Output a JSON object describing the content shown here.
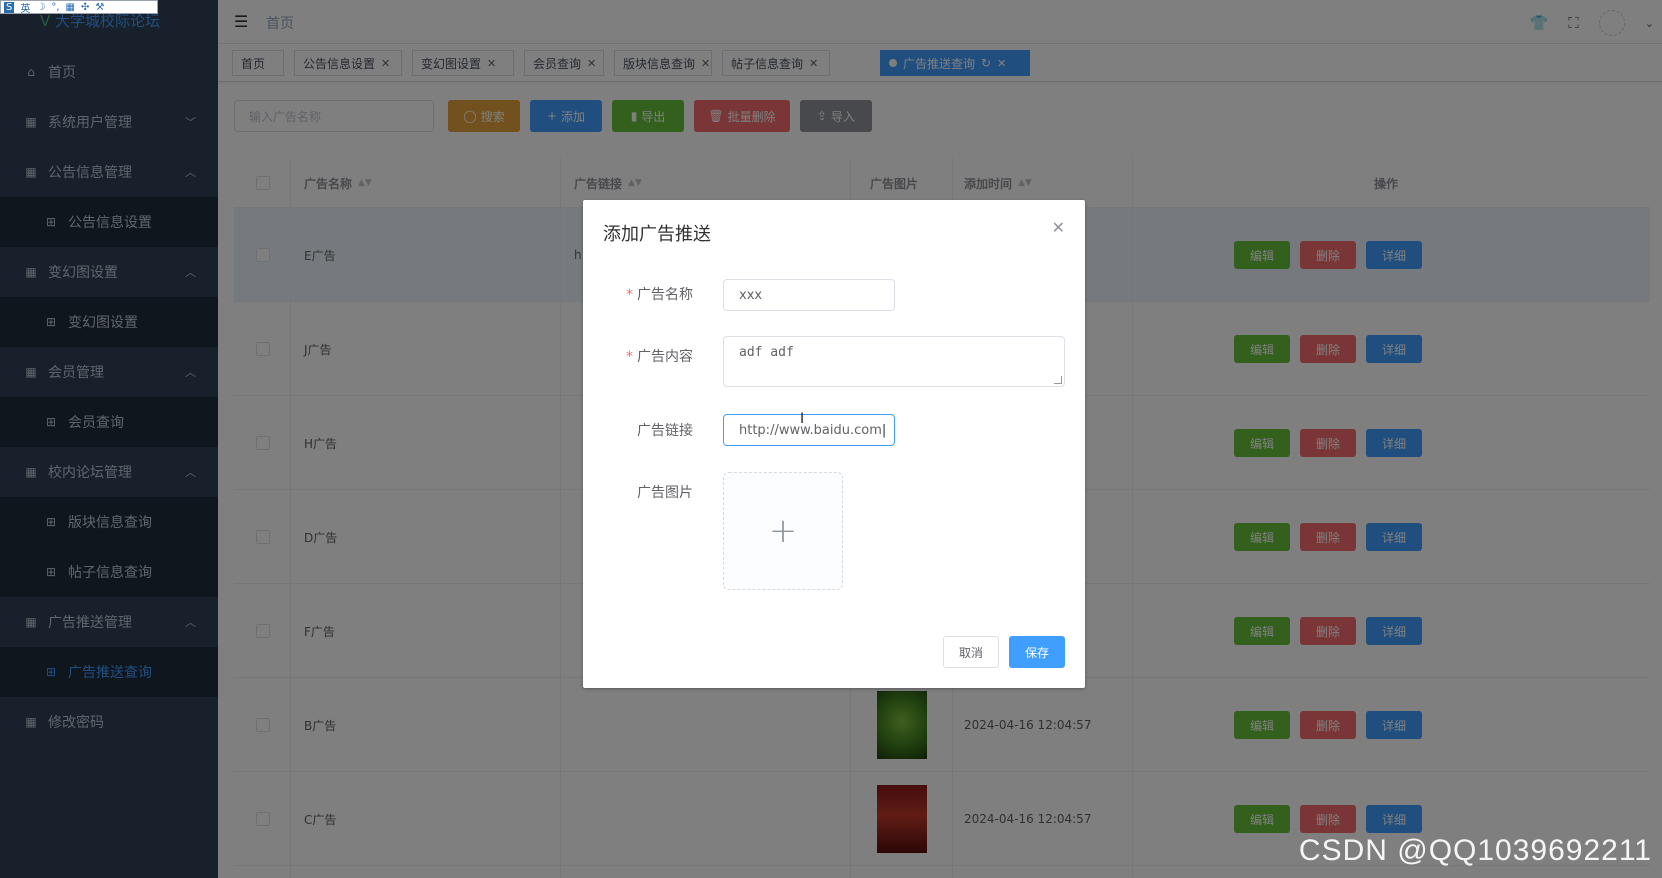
{
  "ime": {
    "items": [
      "S",
      "英",
      "☽",
      "°,",
      "▦",
      "✣",
      "🔧"
    ]
  },
  "sidebar": {
    "logo": "大学城校际论坛",
    "items": [
      {
        "label": "首页",
        "icon": "home-icon",
        "type": "top"
      },
      {
        "label": "系统用户管理",
        "icon": "grid-icon",
        "type": "group",
        "arrow": "down"
      },
      {
        "label": "公告信息管理",
        "icon": "grid-icon",
        "type": "group",
        "arrow": "up"
      },
      {
        "label": "公告信息设置",
        "icon": "apps-icon",
        "type": "sub"
      },
      {
        "label": "变幻图设置",
        "icon": "grid-icon",
        "type": "group",
        "arrow": "up"
      },
      {
        "label": "变幻图设置",
        "icon": "apps-icon",
        "type": "sub"
      },
      {
        "label": "会员管理",
        "icon": "grid-icon",
        "type": "group",
        "arrow": "up"
      },
      {
        "label": "会员查询",
        "icon": "apps-icon",
        "type": "sub"
      },
      {
        "label": "校内论坛管理",
        "icon": "grid-icon",
        "type": "group",
        "arrow": "up"
      },
      {
        "label": "版块信息查询",
        "icon": "apps-icon",
        "type": "sub"
      },
      {
        "label": "帖子信息查询",
        "icon": "apps-icon",
        "type": "sub"
      },
      {
        "label": "广告推送管理",
        "icon": "grid-icon",
        "type": "group",
        "arrow": "up"
      },
      {
        "label": "广告推送查询",
        "icon": "apps-icon",
        "type": "sub",
        "active": true
      },
      {
        "label": "修改密码",
        "icon": "grid-icon",
        "type": "top"
      }
    ]
  },
  "navbar": {
    "breadcrumb": "首页"
  },
  "tags": [
    {
      "label": "首页",
      "closable": false
    },
    {
      "label": "公告信息设置",
      "closable": true
    },
    {
      "label": "变幻图设置",
      "closable": true
    },
    {
      "label": "会员查询",
      "closable": true
    },
    {
      "label": "版块信息查询",
      "closable": true
    },
    {
      "label": "帖子信息查询",
      "closable": true
    },
    {
      "label": "广告推送查询",
      "closable": true,
      "active": true
    }
  ],
  "toolbar": {
    "search_placeholder": "输入广告名称",
    "search_label": "搜索",
    "add_label": "添加",
    "export_label": "导出",
    "batch_delete_label": "批量删除",
    "import_label": "导入"
  },
  "table": {
    "headers": {
      "name": "广告名称",
      "link": "广告链接",
      "image": "广告图片",
      "time": "添加时间",
      "actions": "操作"
    },
    "rows": [
      {
        "name": "E广告",
        "link": "h",
        "time": "",
        "image": ""
      },
      {
        "name": "J广告",
        "link": "",
        "time": "",
        "image": ""
      },
      {
        "name": "H广告",
        "link": "",
        "time": "",
        "image": ""
      },
      {
        "name": "D广告",
        "link": "",
        "time": "",
        "image": ""
      },
      {
        "name": "F广告",
        "link": "",
        "time": "",
        "image": ""
      },
      {
        "name": "B广告",
        "link": "",
        "time": "2024-04-16 12:04:57",
        "image": "green"
      },
      {
        "name": "C广告",
        "link": "",
        "time": "2024-04-16 12:04:57",
        "image": "red"
      }
    ],
    "edit_label": "编辑",
    "delete_label": "删除",
    "detail_label": "详细"
  },
  "dialog": {
    "title": "添加广告推送",
    "name_label": "广告名称",
    "name_value": "xxx",
    "content_label": "广告内容",
    "content_value": "adf adf",
    "link_label": "广告链接",
    "link_value": "http://www.baidu.com",
    "image_label": "广告图片",
    "cancel_label": "取消",
    "save_label": "保存"
  },
  "colors": {
    "warning": "#e6a23c",
    "primary": "#409eff",
    "success": "#67c23a",
    "danger": "#f56c6c",
    "info": "#909399"
  },
  "watermark": "CSDN @QQ1039692211"
}
